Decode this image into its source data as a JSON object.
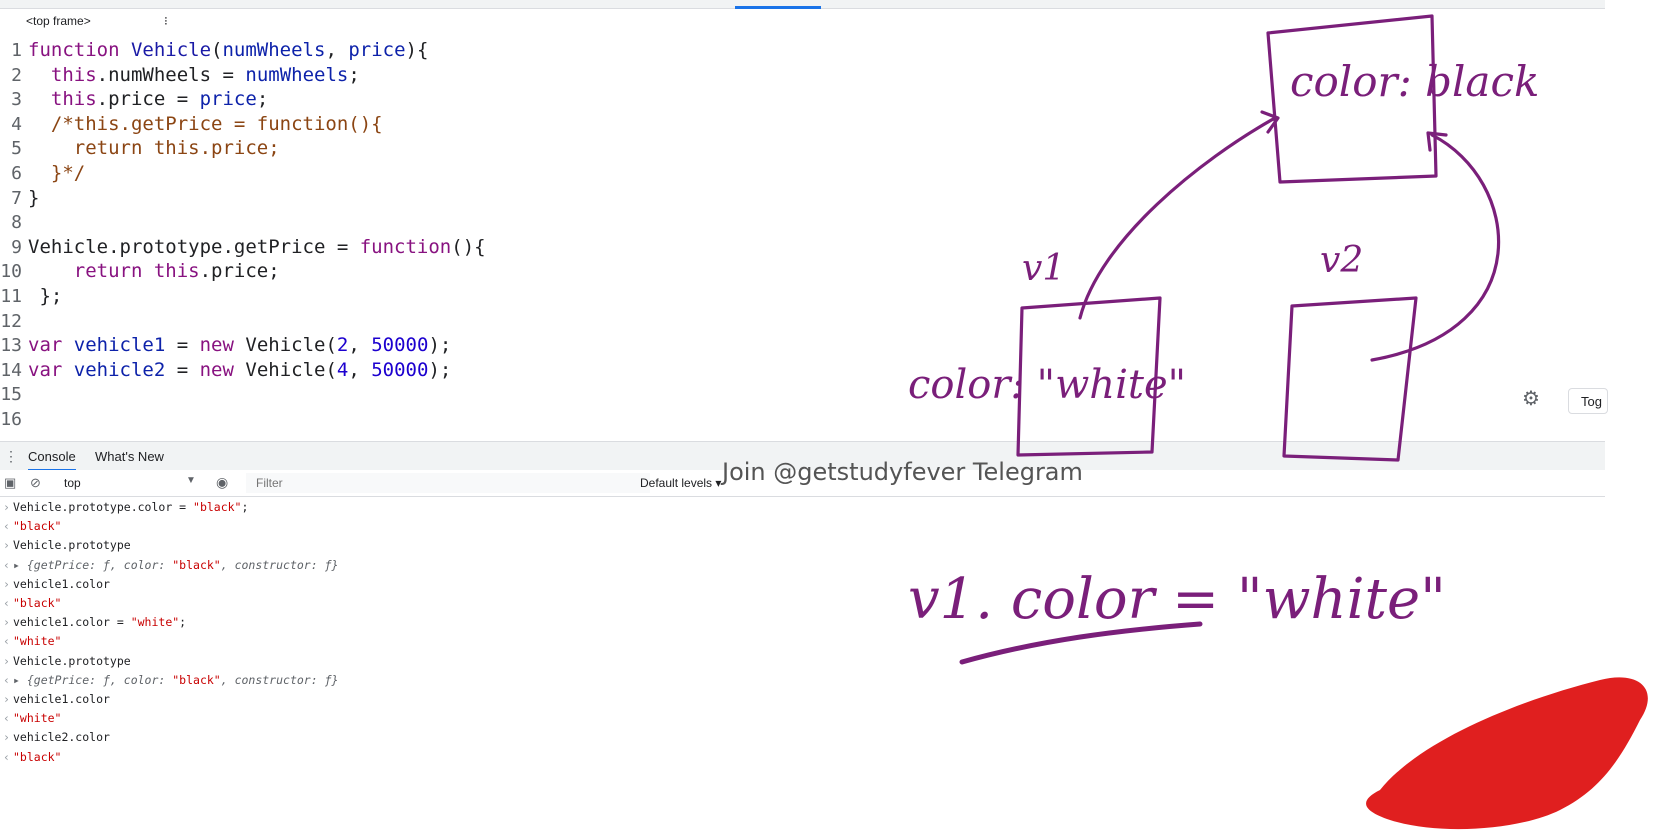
{
  "window": {
    "frame_selector": "<top frame>",
    "frame_selector_arrow": "⁝"
  },
  "editor": {
    "lines": [
      {
        "n": "1",
        "parts": [
          [
            "kw",
            "function "
          ],
          [
            "fn",
            "Vehicle"
          ],
          [
            "pl",
            "("
          ],
          [
            "var",
            "numWheels"
          ],
          [
            "pl",
            ", "
          ],
          [
            "var",
            "price"
          ],
          [
            "pl",
            "){"
          ]
        ]
      },
      {
        "n": "2",
        "parts": [
          [
            "pl",
            "  "
          ],
          [
            "kw",
            "this"
          ],
          [
            "pl",
            ".numWheels = "
          ],
          [
            "var",
            "numWheels"
          ],
          [
            "pl",
            ";"
          ]
        ]
      },
      {
        "n": "3",
        "parts": [
          [
            "pl",
            "  "
          ],
          [
            "kw",
            "this"
          ],
          [
            "pl",
            ".price = "
          ],
          [
            "var",
            "price"
          ],
          [
            "pl",
            ";"
          ]
        ]
      },
      {
        "n": "4",
        "parts": [
          [
            "cm",
            "  /*this.getPrice = function(){"
          ]
        ]
      },
      {
        "n": "5",
        "parts": [
          [
            "cm",
            "    return this.price;"
          ]
        ]
      },
      {
        "n": "6",
        "parts": [
          [
            "cm",
            "  }*/"
          ]
        ]
      },
      {
        "n": "7",
        "parts": [
          [
            "pl",
            "}"
          ]
        ]
      },
      {
        "n": "8",
        "parts": []
      },
      {
        "n": "9",
        "parts": [
          [
            "pl",
            "Vehicle.prototype.getPrice = "
          ],
          [
            "kw",
            "function"
          ],
          [
            "pl",
            "(){"
          ]
        ]
      },
      {
        "n": "10",
        "parts": [
          [
            "pl",
            "    "
          ],
          [
            "kw",
            "return this"
          ],
          [
            "pl",
            ".price;"
          ]
        ]
      },
      {
        "n": "11",
        "parts": [
          [
            "pl",
            " };"
          ]
        ]
      },
      {
        "n": "12",
        "parts": []
      },
      {
        "n": "13",
        "parts": [
          [
            "kw",
            "var "
          ],
          [
            "var",
            "vehicle1"
          ],
          [
            "pl",
            " = "
          ],
          [
            "kw",
            "new "
          ],
          [
            "pl",
            "Vehicle("
          ],
          [
            "nm",
            "2"
          ],
          [
            "pl",
            ", "
          ],
          [
            "nm",
            "50000"
          ],
          [
            "pl",
            ");"
          ]
        ]
      },
      {
        "n": "14",
        "parts": [
          [
            "kw",
            "var "
          ],
          [
            "var",
            "vehicle2"
          ],
          [
            "pl",
            " = "
          ],
          [
            "kw",
            "new "
          ],
          [
            "pl",
            "Vehicle("
          ],
          [
            "nm",
            "4"
          ],
          [
            "pl",
            ", "
          ],
          [
            "nm",
            "50000"
          ],
          [
            "pl",
            ");"
          ]
        ]
      },
      {
        "n": "15",
        "parts": []
      },
      {
        "n": "16",
        "parts": []
      }
    ]
  },
  "editor_footer": {
    "settings_icon": "gear-icon",
    "toggle_label": "Tog"
  },
  "drawer": {
    "tabs": [
      {
        "label": "Console"
      },
      {
        "label": "What's New"
      }
    ]
  },
  "console_toolbar": {
    "context": "top",
    "filter_placeholder": "Filter",
    "levels": "Default levels ▾"
  },
  "watermark": "Join @getstudyfever Telegram",
  "console": {
    "entries": [
      {
        "dir": ">",
        "parts": [
          [
            "in",
            "Vehicle.prototype.color = "
          ],
          [
            "str",
            "\"black\""
          ],
          [
            "in",
            ";"
          ]
        ]
      },
      {
        "dir": "<",
        "parts": [
          [
            "str",
            "\"black\""
          ]
        ]
      },
      {
        "dir": ">",
        "parts": [
          [
            "in",
            "Vehicle.prototype"
          ]
        ]
      },
      {
        "dir": "<",
        "parts": [
          [
            "obj",
            "▸ {getPrice: ƒ, color: "
          ],
          [
            "str",
            "\"black\""
          ],
          [
            "obj",
            ", constructor: ƒ}"
          ]
        ]
      },
      {
        "dir": ">",
        "parts": [
          [
            "in",
            "vehicle1.color"
          ]
        ]
      },
      {
        "dir": "<",
        "parts": [
          [
            "str",
            "\"black\""
          ]
        ]
      },
      {
        "dir": ">",
        "parts": [
          [
            "in",
            "vehicle1.color = "
          ],
          [
            "str",
            "\"white\""
          ],
          [
            "in",
            ";"
          ]
        ]
      },
      {
        "dir": "<",
        "parts": [
          [
            "str",
            "\"white\""
          ]
        ]
      },
      {
        "dir": ">",
        "parts": [
          [
            "in",
            "Vehicle.prototype"
          ]
        ]
      },
      {
        "dir": "<",
        "parts": [
          [
            "obj",
            "▸ {getPrice: ƒ, color: "
          ],
          [
            "str",
            "\"black\""
          ],
          [
            "obj",
            ", constructor: ƒ}"
          ]
        ]
      },
      {
        "dir": ">",
        "parts": [
          [
            "in",
            "vehicle1.color"
          ]
        ]
      },
      {
        "dir": "<",
        "parts": [
          [
            "str",
            "\"white\""
          ]
        ]
      },
      {
        "dir": ">",
        "parts": [
          [
            "in",
            "vehicle2.color"
          ]
        ]
      },
      {
        "dir": "<",
        "parts": [
          [
            "str",
            "\"black\""
          ]
        ]
      }
    ]
  },
  "annotations": {
    "proto_box_text": "color: black",
    "v1_label": "v1",
    "v2_label": "v2",
    "v1_side_text": "color: \"white\"",
    "assignment_text": "v1. color = \"white\"",
    "ink_color": "#7a1f7a",
    "scribble_color": "#e01f1f"
  }
}
